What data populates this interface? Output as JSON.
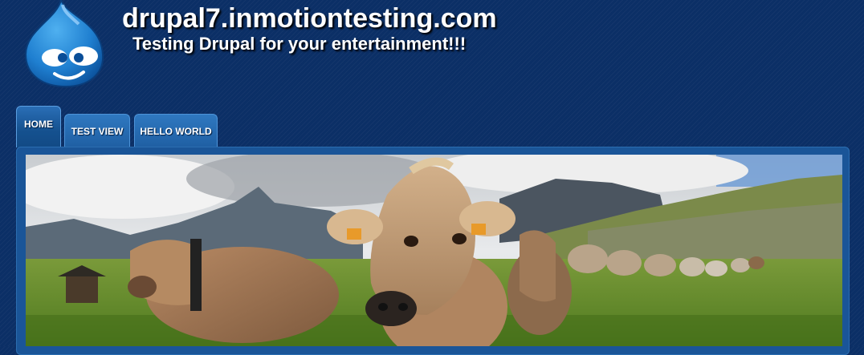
{
  "site": {
    "name": "drupal7.inmotiontesting.com",
    "slogan": "Testing Drupal for your entertainment!!!"
  },
  "nav": {
    "tabs": [
      {
        "label": "HOME",
        "active": true
      },
      {
        "label": "TEST VIEW",
        "active": false
      },
      {
        "label": "HELLO WORLD",
        "active": false
      }
    ]
  },
  "colors": {
    "page_bg": "#0b2f66",
    "tab_bg": "#2f78c0",
    "logo_blue": "#1f7fd0"
  },
  "icons": {
    "logo": "drupal-drop-logo"
  }
}
